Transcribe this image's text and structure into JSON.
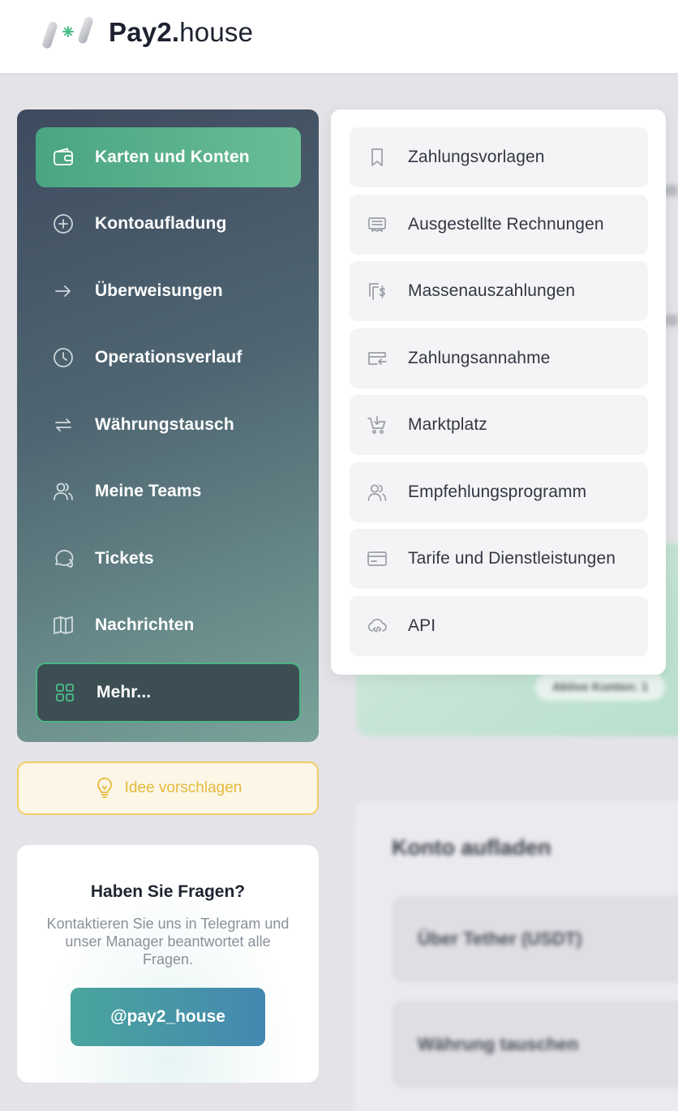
{
  "brand": {
    "name_bold": "Pay2.",
    "name_light": "house"
  },
  "sidebar": {
    "items": [
      {
        "label": "Karten und Konten",
        "icon": "wallet-icon"
      },
      {
        "label": "Kontoaufladung",
        "icon": "plus-circle-icon"
      },
      {
        "label": "Überweisungen",
        "icon": "arrow-right-icon"
      },
      {
        "label": "Operationsverlauf",
        "icon": "clock-icon"
      },
      {
        "label": "Währungstausch",
        "icon": "swap-icon"
      },
      {
        "label": "Meine Teams",
        "icon": "users-icon"
      },
      {
        "label": "Tickets",
        "icon": "chat-icon"
      },
      {
        "label": "Nachrichten",
        "icon": "book-icon"
      },
      {
        "label": "Mehr...",
        "icon": "grid-icon"
      }
    ],
    "active_index": 0
  },
  "idea": {
    "label": "Idee vorschlagen",
    "icon": "lightbulb-icon"
  },
  "help": {
    "title": "Haben Sie Fragen?",
    "text": "Kontaktieren Sie uns in Telegram und unser Manager beantwortet alle Fragen.",
    "button": "@pay2_house"
  },
  "more_menu": {
    "items": [
      {
        "label": "Zahlungsvorlagen",
        "icon": "bookmark-icon"
      },
      {
        "label": "Ausgestellte Rechnungen",
        "icon": "receipt-icon"
      },
      {
        "label": "Massenauszahlungen",
        "icon": "mass-payout-icon"
      },
      {
        "label": "Zahlungsannahme",
        "icon": "payment-accept-icon"
      },
      {
        "label": "Marktplatz",
        "icon": "cart-icon"
      },
      {
        "label": "Empfehlungsprogramm",
        "icon": "users-icon"
      },
      {
        "label": "Tarife und Dienstleistungen",
        "icon": "card-icon"
      },
      {
        "label": "API",
        "icon": "cloud-code-icon"
      }
    ]
  },
  "background": {
    "active_accounts": "Aktive Konten: 1",
    "topup_title": "Konto aufladen",
    "topup_options": [
      "Über Tether (USDT)",
      "Währung tauschen"
    ]
  },
  "colors": {
    "accent_green": "#4aa583",
    "idea_yellow": "#e6b83b",
    "telegram_button": "#4488b0"
  }
}
